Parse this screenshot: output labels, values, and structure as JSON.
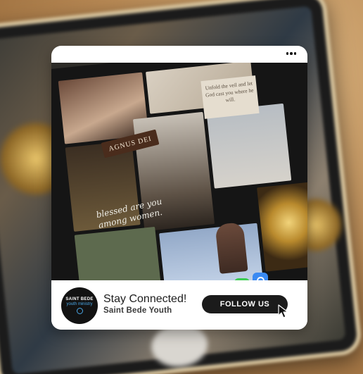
{
  "post": {
    "menu_icon": "more-horizontal-icon",
    "image_text": {
      "banner": "AGNUS DEI",
      "card": "Unfold the veil and let God cast you where he will.",
      "script": "blessed are you among women."
    },
    "avatar": {
      "line1": "SAINT BEDE",
      "line2": "youth ministry",
      "accent_color": "#4aa8e8"
    },
    "title": "Stay Connected!",
    "subtitle": "Saint Bede Youth",
    "follow_label": "FOLLOW US",
    "cursor_icon": "mouse-pointer-icon"
  },
  "colors": {
    "button_bg": "#1b1b1b",
    "button_text": "#ffffff",
    "card_bg": "#ffffff"
  }
}
